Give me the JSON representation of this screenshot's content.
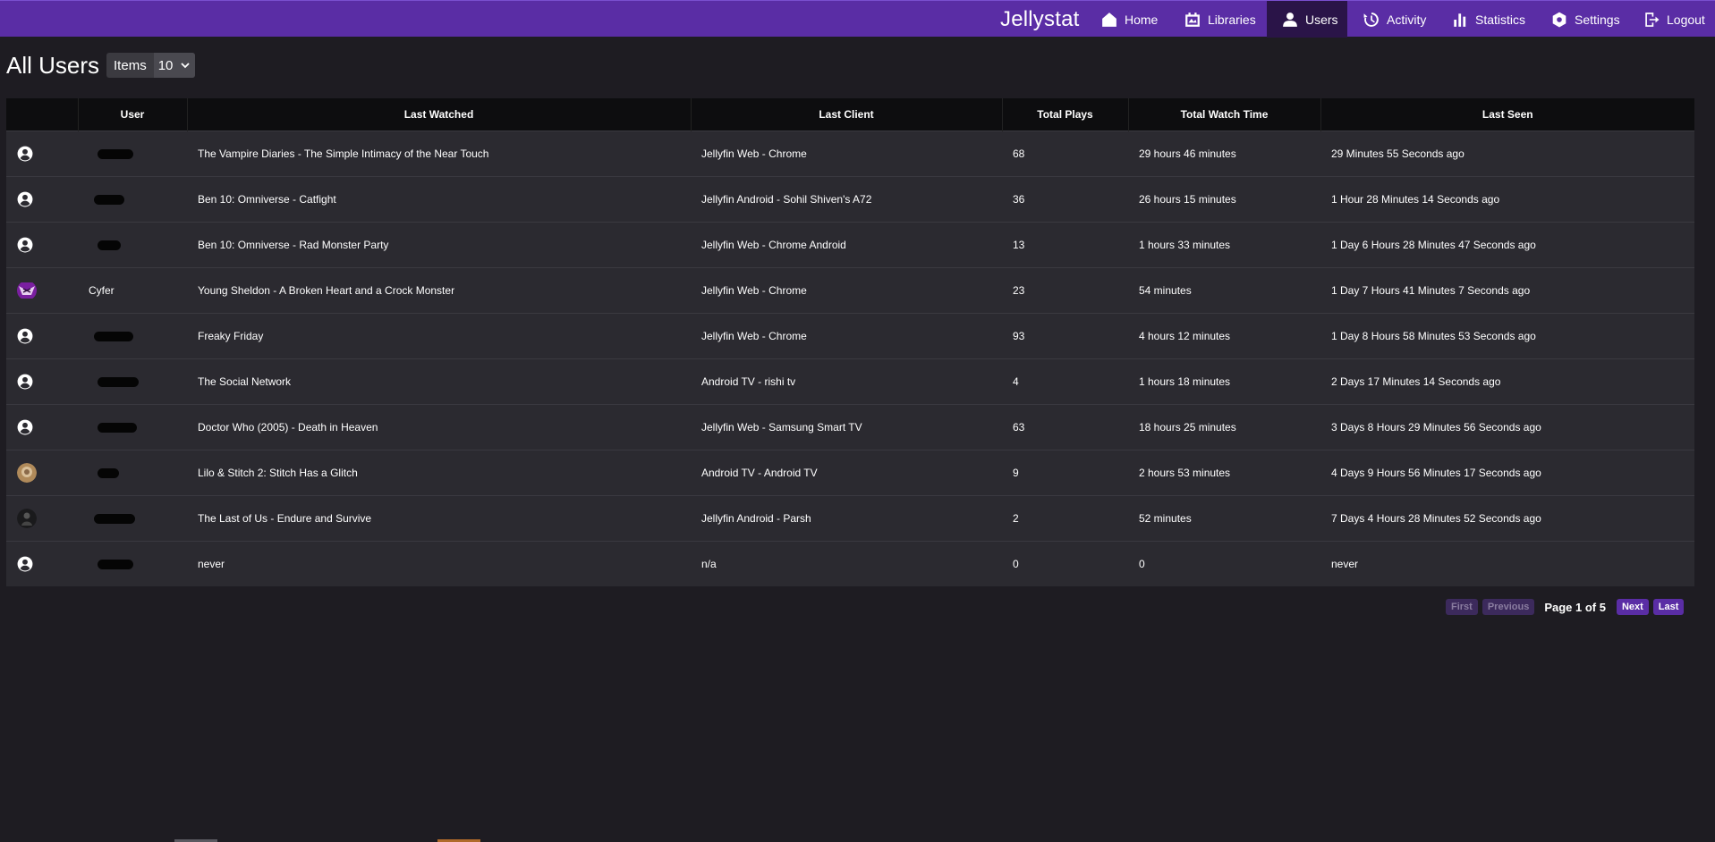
{
  "app": {
    "brand": "Jellystat",
    "accent_color": "#5a2da5"
  },
  "nav": {
    "items": [
      {
        "label": "Home",
        "icon": "home-icon"
      },
      {
        "label": "Libraries",
        "icon": "libraries-icon"
      },
      {
        "label": "Users",
        "icon": "user-icon",
        "active": true
      },
      {
        "label": "Activity",
        "icon": "history-icon"
      },
      {
        "label": "Statistics",
        "icon": "bar-chart-icon"
      },
      {
        "label": "Settings",
        "icon": "gear-icon"
      },
      {
        "label": "Logout",
        "icon": "logout-icon"
      }
    ]
  },
  "page": {
    "title": "All Users",
    "items_label": "Items",
    "items_value": "10"
  },
  "table": {
    "headers": [
      "",
      "User",
      "Last Watched",
      "Last Client",
      "Total Plays",
      "Total Watch Time",
      "Last Seen"
    ],
    "rows": [
      {
        "avatar": "default",
        "user": "",
        "last_watched": "The Vampire Diaries - The Simple Intimacy of the Near Touch",
        "last_client": "Jellyfin Web - Chrome",
        "total_plays": "68",
        "watch_time": "29 hours 46 minutes",
        "last_seen": "29 Minutes 55 Seconds ago"
      },
      {
        "avatar": "default",
        "user": "",
        "last_watched": "Ben 10: Omniverse - Catfight",
        "last_client": "Jellyfin Android - Sohil Shiven's A72",
        "total_plays": "36",
        "watch_time": "26 hours 15 minutes",
        "last_seen": "1 Hour 28 Minutes 14 Seconds ago"
      },
      {
        "avatar": "default",
        "user": "",
        "last_watched": "Ben 10: Omniverse - Rad Monster Party",
        "last_client": "Jellyfin Web - Chrome Android",
        "total_plays": "13",
        "watch_time": "1 hours 33 minutes",
        "last_seen": "1 Day 6 Hours 28 Minutes 47 Seconds ago"
      },
      {
        "avatar": "image-purple",
        "user": "Cyfer",
        "last_watched": "Young Sheldon - A Broken Heart and a Crock Monster",
        "last_client": "Jellyfin Web - Chrome",
        "total_plays": "23",
        "watch_time": "54 minutes",
        "last_seen": "1 Day 7 Hours 41 Minutes 7 Seconds ago"
      },
      {
        "avatar": "default",
        "user": "",
        "last_watched": "Freaky Friday",
        "last_client": "Jellyfin Web - Chrome",
        "total_plays": "93",
        "watch_time": "4 hours 12 minutes",
        "last_seen": "1 Day 8 Hours 58 Minutes 53 Seconds ago"
      },
      {
        "avatar": "default",
        "user": "",
        "last_watched": "The Social Network",
        "last_client": "Android TV - rishi tv",
        "total_plays": "4",
        "watch_time": "1 hours 18 minutes",
        "last_seen": "2 Days 17 Minutes 14 Seconds ago"
      },
      {
        "avatar": "default",
        "user": "",
        "last_watched": "Doctor Who (2005) - Death in Heaven",
        "last_client": "Jellyfin Web - Samsung Smart TV",
        "total_plays": "63",
        "watch_time": "18 hours 25 minutes",
        "last_seen": "3 Days 8 Hours 29 Minutes 56 Seconds ago"
      },
      {
        "avatar": "image-tan",
        "user": "",
        "last_watched": "Lilo & Stitch 2: Stitch Has a Glitch",
        "last_client": "Android TV - Android TV",
        "total_plays": "9",
        "watch_time": "2 hours 53 minutes",
        "last_seen": "4 Days 9 Hours 56 Minutes 17 Seconds ago"
      },
      {
        "avatar": "image-dark",
        "user": "",
        "last_watched": "The Last of Us - Endure and Survive",
        "last_client": "Jellyfin Android - Parsh",
        "total_plays": "2",
        "watch_time": "52 minutes",
        "last_seen": "7 Days 4 Hours 28 Minutes 52 Seconds ago"
      },
      {
        "avatar": "default",
        "user": "",
        "last_watched": "never",
        "last_client": "n/a",
        "total_plays": "0",
        "watch_time": "0",
        "last_seen": "never"
      }
    ]
  },
  "pagination": {
    "first": "First",
    "previous": "Previous",
    "info": "Page 1 of 5",
    "next": "Next",
    "last": "Last"
  }
}
